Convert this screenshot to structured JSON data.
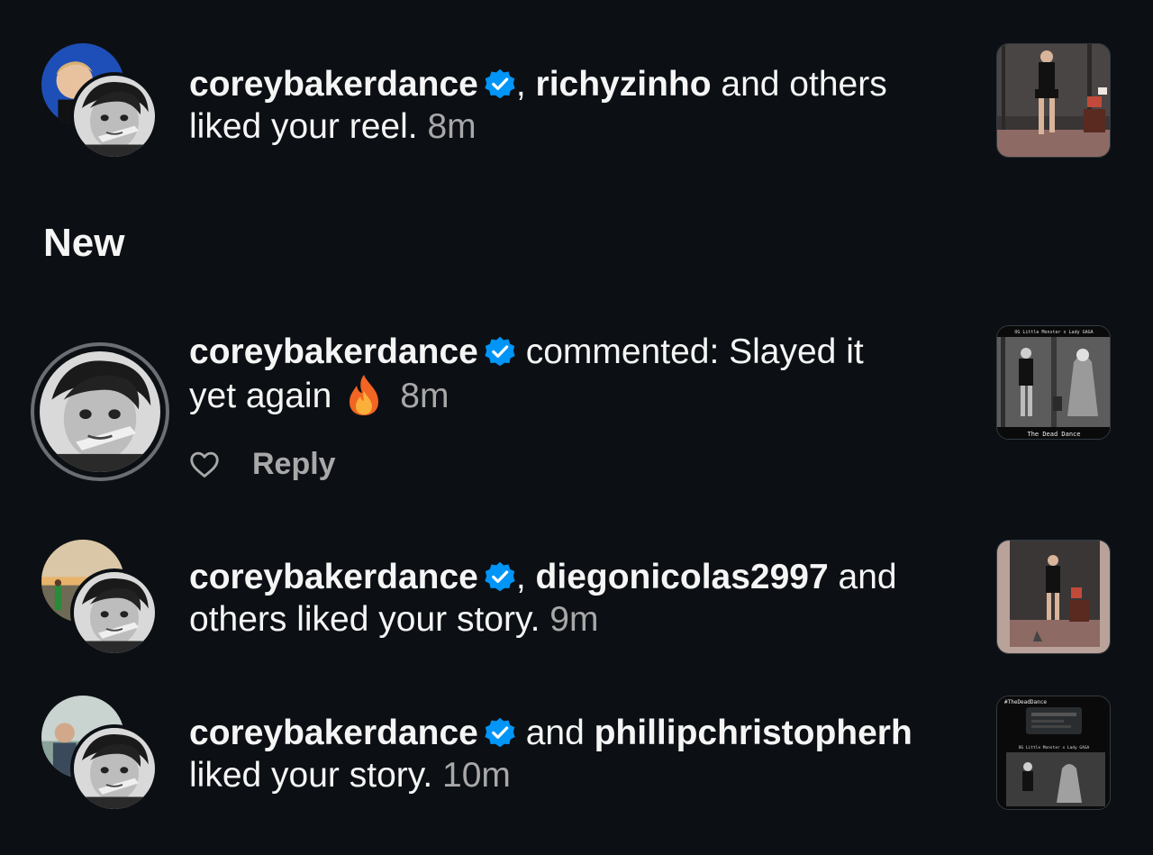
{
  "notifications": [
    {
      "user": "coreybakerdance",
      "joiner": ", ",
      "other_user": "richyzinho",
      "line_end": " and others",
      "line2": "liked your reel. ",
      "time": "8m",
      "back_avatar": "user-avatar-blue",
      "front_avatar": "coreybakerdance-avatar",
      "thumbnail": "reel-dance-thumbnail"
    },
    {
      "user": "coreybakerdance",
      "joiner": ", ",
      "other_user": "diegonicolas2997",
      "line_end": " and",
      "line2": "others liked your story. ",
      "time": "9m",
      "back_avatar": "user-avatar-sunset",
      "front_avatar": "coreybakerdance-avatar",
      "thumbnail": "story-dance-thumbnail"
    },
    {
      "user": "coreybakerdance",
      "joiner": " and ",
      "other_user": "phillipchristopherh",
      "line_end": "",
      "line2": "liked your story. ",
      "time": "10m",
      "back_avatar": "user-avatar-beach",
      "front_avatar": "coreybakerdance-avatar",
      "thumbnail": "story-thedeaddance-thumbnail"
    }
  ],
  "section_new": "New",
  "comment": {
    "user": "coreybakerdance",
    "action": " commented: Slayed it",
    "line2": "yet again",
    "emoji": "fire-emoji",
    "time": "8m",
    "reply_label": "Reply",
    "thumbnail": "thedeaddance-thumbnail",
    "thumb_top_text": "OG Little Monster x Lady GAGA",
    "thumb_bottom_text": "The Dead Dance"
  },
  "story_thumb_text": "#TheDeadDance",
  "story_thumb_sub": "OG Little Monster x Lady GAGA",
  "colors": {
    "background": "#0c1014",
    "text": "#f5f5f5",
    "muted": "#a8a8a8",
    "verified": "#0095f6"
  }
}
